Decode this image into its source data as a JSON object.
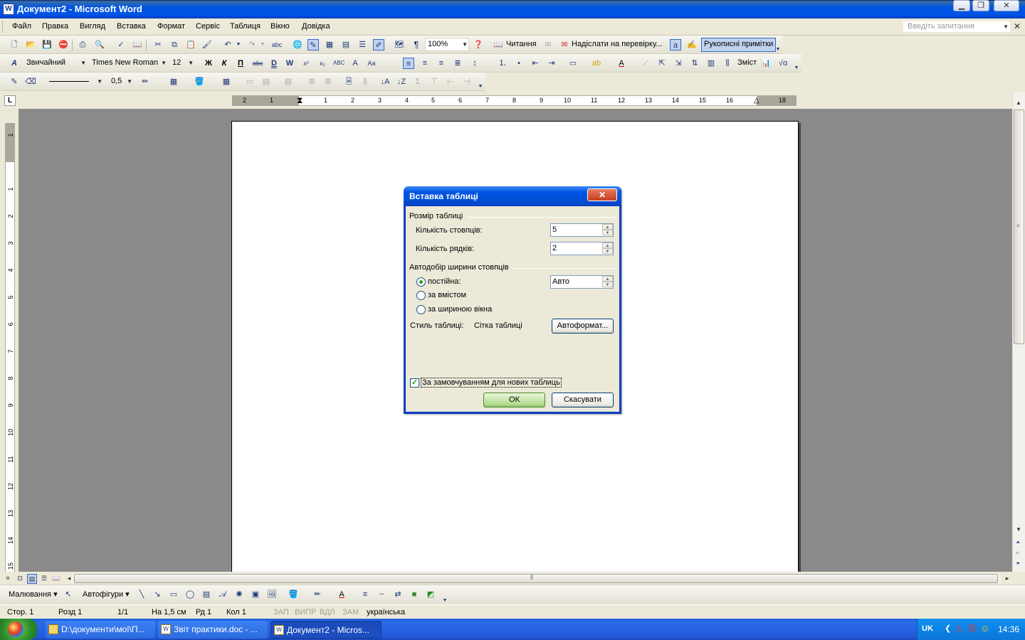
{
  "window": {
    "title": "Документ2 - Microsoft Word",
    "icon_letter": "W",
    "controls": [
      "minimize-icon",
      "restore-icon",
      "close-icon"
    ]
  },
  "menu": {
    "items": [
      "Файл",
      "Правка",
      "Вигляд",
      "Вставка",
      "Формат",
      "Сервіс",
      "Таблиця",
      "Вікно",
      "Довідка"
    ],
    "ask_placeholder": "Введіть запитання"
  },
  "toolbar_standard": {
    "zoom": "100%",
    "reading_label": "Читання",
    "send_review_label": "Надіслати на перевірку...",
    "ink_annotations_label": "Рукописні примітки"
  },
  "toolbar_formatting": {
    "style": "Звичайний",
    "font": "Times New Roman",
    "size": "12",
    "bold": "Ж",
    "italic": "К",
    "underline": "П",
    "toc_label": "Зміст"
  },
  "toolbar_tables": {
    "line_weight": "0,5"
  },
  "ruler": {
    "marks": [
      "2",
      "1",
      "1",
      "2",
      "3",
      "4",
      "5",
      "6",
      "7",
      "8",
      "9",
      "10",
      "11",
      "12",
      "13",
      "14",
      "15",
      "16",
      "18"
    ],
    "vmarks": [
      "1",
      "1",
      "2",
      "3",
      "4",
      "5",
      "6",
      "7",
      "8",
      "9",
      "10",
      "11",
      "12",
      "13",
      "14",
      "15"
    ],
    "tab_selector": "L"
  },
  "dialog": {
    "title": "Вставка таблиці",
    "size_group": "Розмір таблиці",
    "columns_label": "Кількість стовпців:",
    "columns_value": "5",
    "rows_label": "Кількість рядків:",
    "rows_value": "2",
    "autofit_group": "Автодобір ширини стовпців",
    "radio_fixed": "постійна:",
    "fixed_value": "Авто",
    "radio_content": "за вмістом",
    "radio_window": "за шириною вікна",
    "style_label": "Стиль таблиці:",
    "style_value": "Сітка таблиці",
    "autoformat_button": "Автоформат...",
    "default_checkbox": "За замовчуванням для нових таблиць",
    "default_checked": true,
    "selected_option": "постійна",
    "ok": "ОК",
    "cancel": "Скасувати"
  },
  "drawing_toolbar": {
    "draw_menu": "Малювання",
    "autoshapes_menu": "Автофігури"
  },
  "status": {
    "page": "Стор. 1",
    "section": "Розд 1",
    "pages": "1/1",
    "at": "На 1,5 см",
    "line": "Рд 1",
    "col": "Кол 1",
    "rec": "ЗАП",
    "trk": "ВИПР",
    "ext": "ВДЛ",
    "ovr": "ЗАМ",
    "language": "українська"
  },
  "taskbar": {
    "items": [
      "D:\\документи\\мої\\П...",
      "Звіт практики.doc - ...",
      "Документ2 - Micros..."
    ],
    "active_index": 2,
    "lang": "UK",
    "clock": "14:36"
  }
}
